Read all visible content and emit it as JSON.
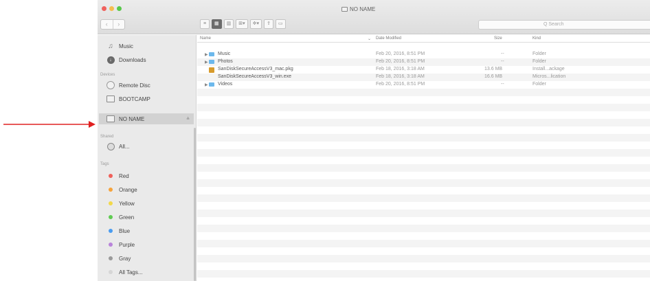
{
  "window": {
    "title": "NO NAME"
  },
  "toolbar": {
    "back": "‹",
    "forward": "›",
    "view_buttons": [
      "≡",
      "▦",
      "▥",
      "⊞▾",
      "✲▾",
      "⇪",
      "▭"
    ],
    "search_placeholder": "Q Search"
  },
  "sidebar": {
    "items_top": [
      {
        "label": "Music",
        "icon": "music-note-icon"
      },
      {
        "label": "Downloads",
        "icon": "downloads-icon"
      }
    ],
    "devices_header": "Devices",
    "devices": [
      {
        "label": "Remote Disc",
        "icon": "disc-icon"
      },
      {
        "label": "BOOTCAMP",
        "icon": "disk-icon"
      },
      {
        "label": "NO NAME",
        "icon": "disk-icon",
        "selected": true
      }
    ],
    "eject": "≜",
    "shared_header": "Shared",
    "shared": [
      {
        "label": "All...",
        "icon": "network-globe-icon"
      }
    ],
    "tags_header": "Tags",
    "tags": [
      {
        "label": "Red",
        "color": "#f0605a"
      },
      {
        "label": "Orange",
        "color": "#f6a33b"
      },
      {
        "label": "Yellow",
        "color": "#f3d94a"
      },
      {
        "label": "Green",
        "color": "#5fcb52"
      },
      {
        "label": "Blue",
        "color": "#4a9cf0"
      },
      {
        "label": "Purple",
        "color": "#b984da"
      },
      {
        "label": "Gray",
        "color": "#9a9a9a"
      },
      {
        "label": "All Tags...",
        "color": "#d6d6d6"
      }
    ]
  },
  "columns": {
    "name": "Name",
    "date": "Date Modified",
    "size": "Size",
    "kind": "Kind"
  },
  "files": [
    {
      "name": "Music",
      "date": "Feb 20, 2016, 8:51 PM",
      "size": "--",
      "kind": "Folder",
      "type": "folder"
    },
    {
      "name": "Photos",
      "date": "Feb 20, 2016, 8:51 PM",
      "size": "--",
      "kind": "Folder",
      "type": "folder"
    },
    {
      "name": "SanDiskSecureAccessV3_mac.pkg",
      "date": "Feb 18, 2016, 3:18 AM",
      "size": "13.6 MB",
      "kind": "Install...ackage",
      "type": "pkg"
    },
    {
      "name": "SanDiskSecureAccessV3_win.exe",
      "date": "Feb 18, 2016, 3:18 AM",
      "size": "16.6 MB",
      "kind": "Micros...lication",
      "type": "exe"
    },
    {
      "name": "Videos",
      "date": "Feb 20, 2016, 8:51 PM",
      "size": "--",
      "kind": "Folder",
      "type": "folder"
    }
  ],
  "colors": {
    "annotation_arrow": "#e02020",
    "selection": "#d2d2d2",
    "folder": "#6cb8ec"
  }
}
